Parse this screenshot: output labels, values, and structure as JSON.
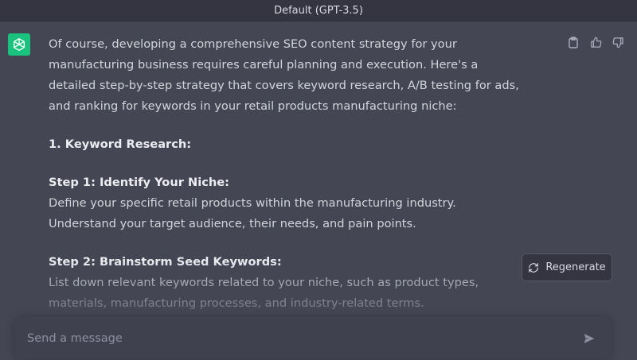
{
  "header": {
    "model_label": "Default (GPT-3.5)"
  },
  "message": {
    "avatar_icon": "openai-logo-icon",
    "intro": "Of course, developing a comprehensive SEO content strategy for your manufacturing business requires careful planning and execution. Here's a detailed step-by-step strategy that covers keyword research, A/B testing for ads, and ranking for keywords in your retail products manufacturing niche:",
    "section_heading": "1. Keyword Research:",
    "step1_title": "Step 1: Identify Your Niche:",
    "step1_text": "Define your specific retail products within the manufacturing industry. Understand your target audience, their needs, and pain points.",
    "step2_title": "Step 2: Brainstorm Seed Keywords:",
    "step2_text": "List down relevant keywords related to your niche, such as product types, materials, manufacturing processes, and industry-related terms."
  },
  "actions": {
    "copy_icon": "clipboard-icon",
    "thumbs_up_icon": "thumbs-up-icon",
    "thumbs_down_icon": "thumbs-down-icon"
  },
  "regenerate": {
    "label": "Regenerate",
    "icon": "refresh-icon"
  },
  "composer": {
    "placeholder": "Send a message",
    "value": "",
    "send_icon": "send-icon"
  },
  "colors": {
    "background": "#444654",
    "topbar": "#343541",
    "accent": "#19c37d",
    "input": "#40414f"
  }
}
